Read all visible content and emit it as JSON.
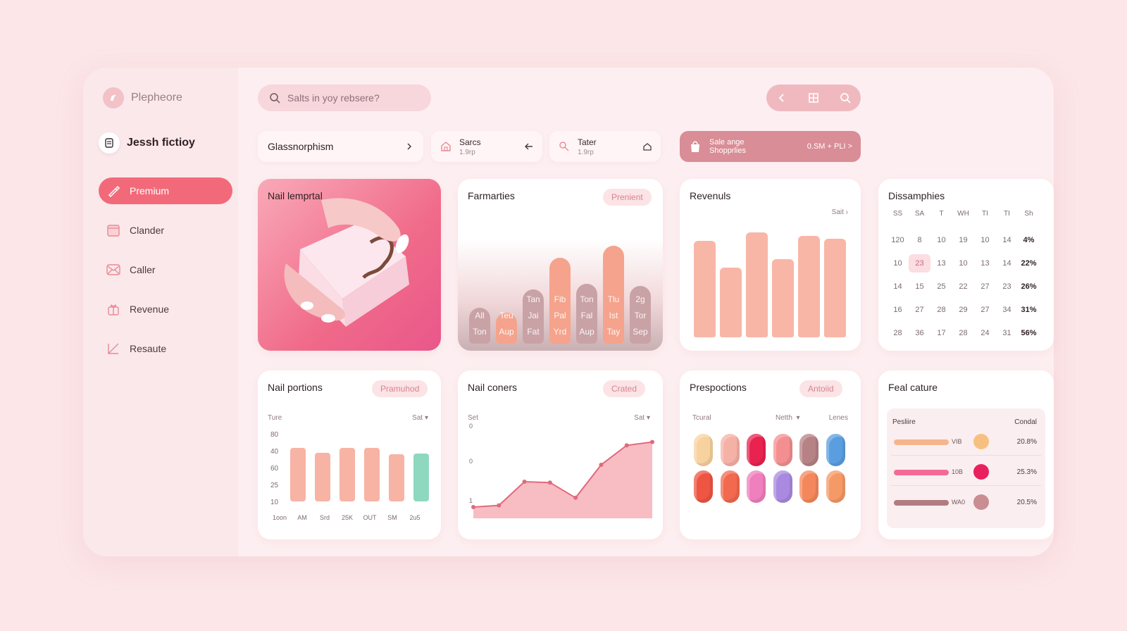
{
  "app": {
    "name": "Plepheore",
    "user": "Jessh fictioy"
  },
  "nav": [
    {
      "label": "Premium",
      "icon": "brush-icon",
      "active": true
    },
    {
      "label": "Clander",
      "icon": "calendar-icon"
    },
    {
      "label": "Caller",
      "icon": "mail-icon"
    },
    {
      "label": "Revenue",
      "icon": "gift-icon"
    },
    {
      "label": "Resaute",
      "icon": "edit-icon"
    }
  ],
  "search": {
    "placeholder": "Salts in yoy rebsere?"
  },
  "toolbar": {
    "icons": [
      "chevron-left-icon",
      "grid-icon",
      "search-icon"
    ]
  },
  "filters": [
    {
      "label": "Glassnorphism"
    },
    {
      "label": "Sarcs",
      "sub": "1.9rp"
    },
    {
      "label": "Tater",
      "sub": "1.9rp"
    }
  ],
  "sale": {
    "line1": "Sale ange",
    "line2": "Shopprlies",
    "value": "0.SM + PLI >"
  },
  "cards": {
    "nail_template": {
      "title": "Nail lemprtal"
    },
    "farmarties": {
      "title": "Farmarties",
      "badge": "Prenient",
      "bars": [
        {
          "v": 0.3,
          "labels": [
            "All",
            "Ton"
          ],
          "color": "#c9a2a6"
        },
        {
          "v": 0.26,
          "labels": [
            "Teu",
            "Aup"
          ],
          "color": "#f5a38c"
        },
        {
          "v": 0.45,
          "labels": [
            "Tan",
            "Jai",
            "Fat"
          ],
          "color": "#c9a2a6"
        },
        {
          "v": 0.72,
          "labels": [
            "Fib",
            "Pal",
            "Yrd"
          ],
          "color": "#f5a38c"
        },
        {
          "v": 0.5,
          "labels": [
            "Ton",
            "Fal",
            "Aup"
          ],
          "color": "#c9a2a6"
        },
        {
          "v": 0.82,
          "labels": [
            "Tlu",
            "Ist",
            "Tay"
          ],
          "color": "#f5a38c"
        },
        {
          "v": 0.48,
          "labels": [
            "2g",
            "Tor",
            "Sep"
          ],
          "color": "#c9a2a6"
        }
      ]
    },
    "revenuls": {
      "title": "Revenuls",
      "link": "Sait",
      "bars": [
        0.83,
        0.6,
        0.9,
        0.67,
        0.87,
        0.85
      ]
    },
    "dissamphies": {
      "title": "Dissamphies",
      "headers": [
        "SS",
        "SA",
        "T",
        "WH",
        "TI",
        "TI",
        "Sh"
      ],
      "rows": [
        [
          "120",
          "8",
          "10",
          "19",
          "10",
          "14",
          "4%"
        ],
        [
          "10",
          "23",
          "13",
          "10",
          "13",
          "14",
          "22%"
        ],
        [
          "14",
          "15",
          "25",
          "22",
          "27",
          "23",
          "26%"
        ],
        [
          "16",
          "27",
          "28",
          "29",
          "27",
          "34",
          "31%"
        ],
        [
          "28",
          "36",
          "17",
          "28",
          "24",
          "31",
          "56%"
        ]
      ]
    },
    "nail_portions": {
      "title": "Nail portions",
      "badge": "Pramuhod",
      "label_left": "Ture",
      "label_right": "Sat",
      "yticks": [
        "80",
        "40",
        "60",
        "25",
        "10"
      ],
      "categories": [
        "1oon",
        "AM",
        "Srd",
        "25K",
        "OUT",
        "SM",
        "2u5"
      ],
      "bars": [
        {
          "v": 0.8,
          "color": "#f7b3a4"
        },
        {
          "v": 0.73,
          "color": "#f7b3a4"
        },
        {
          "v": 0.8,
          "color": "#f7b3a4"
        },
        {
          "v": 0.8,
          "color": "#f7b3a4"
        },
        {
          "v": 0.7,
          "color": "#f7b3a4"
        },
        {
          "v": 0.72,
          "color": "#8fd8c0"
        }
      ]
    },
    "nail_coners": {
      "title": "Nail coners",
      "badge": "Crated",
      "label_left": "Set",
      "label_right": "Sat",
      "yticks": [
        "0",
        "0",
        "1"
      ],
      "points": [
        0.05,
        0.07,
        0.35,
        0.34,
        0.16,
        0.55,
        0.78,
        0.82
      ]
    },
    "prespoctions": {
      "title": "Prespoctions",
      "badge": "Antoiid",
      "label_left": "Tcural",
      "label_mid": "Netth",
      "label_right": "Lenes",
      "swatches": [
        "#f8d29e",
        "#f6b1a6",
        "#e8234f",
        "#f48f91",
        "#b78286",
        "#5b9ee0",
        "#ee5542",
        "#f2694f",
        "#f07fbd",
        "#a98ae0",
        "#f4885c",
        "#f59a66"
      ]
    },
    "feal_cature": {
      "title": "Feal cature",
      "col_left": "Pesliire",
      "col_right": "Condal",
      "rows": [
        {
          "label": "VIB",
          "value": "20.8%",
          "bar": "#f7b58c",
          "dot": "#f8c080"
        },
        {
          "label": "10B",
          "value": "25.3%",
          "bar": "#f26b98",
          "dot": "#ea1f5e"
        },
        {
          "label": "WA0",
          "value": "20.5%",
          "bar": "#b07c80",
          "dot": "#c98d92"
        }
      ]
    }
  }
}
